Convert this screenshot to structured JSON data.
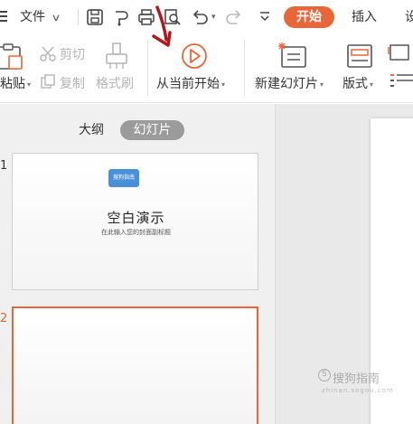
{
  "menubar": {
    "file_label": "文件",
    "quick_access": [
      "save-icon",
      "format-painter-icon",
      "print-icon",
      "print-preview-icon",
      "undo-icon",
      "redo-icon",
      "more-icon"
    ],
    "tabs": [
      {
        "label": "开始",
        "active": true
      },
      {
        "label": "插入",
        "active": false
      },
      {
        "label": "设",
        "active": false
      }
    ]
  },
  "ribbon": {
    "paste_label": "粘贴",
    "cut_label": "剪切",
    "copy_label": "复制",
    "format_painter_label": "格式刷",
    "play_from_current_label": "从当前开始",
    "new_slide_label": "新建幻灯片",
    "layout_label": "版式"
  },
  "panel": {
    "outline_tab": "大纲",
    "slides_tab": "幻灯片",
    "slides": [
      {
        "number": "1",
        "badge": "搜狗指南",
        "title": "空白演示",
        "subtitle": "在此输入您的封面副标题"
      },
      {
        "number": "2"
      }
    ]
  },
  "watermark": {
    "main": "搜狗指南",
    "sub": "zhinan.sogou.com"
  },
  "colors": {
    "accent": "#e8673a",
    "badge_blue": "#4a90d9",
    "annotation_red": "#b0191e"
  }
}
